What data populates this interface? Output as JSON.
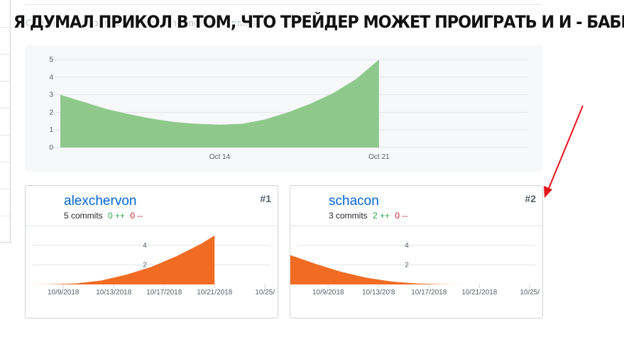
{
  "caption": "Я ДУМАЛ ПРИКОЛ В ТОМ, ЧТО ТРЕЙДЕР МОЖЕТ ПРОИГРАТЬ И И - БАБКИ",
  "subtitle": "Contributions to master, excluding merge commits",
  "colors": {
    "main_area": "#8ec98b",
    "user_area": "#f26b22",
    "link": "#0366d6",
    "add": "#28a745",
    "del": "#cb2431",
    "arrow": "#e8141b"
  },
  "chart_data": [
    {
      "type": "area",
      "title": "",
      "x_tick_labels": [
        "Oct 14",
        "Oct 21"
      ],
      "y_tick_labels": [
        "0",
        "1",
        "2",
        "3",
        "4",
        "5"
      ],
      "ylim": [
        0,
        5
      ],
      "x_range": [
        "10/7/2018",
        "10/23/2018"
      ],
      "x": [
        "10/7/2018",
        "10/8/2018",
        "10/9/2018",
        "10/10/2018",
        "10/11/2018",
        "10/12/2018",
        "10/13/2018",
        "10/14/2018",
        "10/15/2018",
        "10/16/2018",
        "10/17/2018",
        "10/18/2018",
        "10/19/2018",
        "10/20/2018",
        "10/21/2018"
      ],
      "series": [
        {
          "values": [
            3.0,
            2.6,
            2.2,
            1.9,
            1.65,
            1.45,
            1.35,
            1.3,
            1.35,
            1.6,
            2.0,
            2.5,
            3.1,
            3.9,
            5.0
          ]
        }
      ],
      "grid": true
    },
    {
      "type": "area",
      "title": "alexchervon",
      "x_tick_labels": [
        "10/9/2018",
        "10/13/2018",
        "10/17/2018",
        "10/21/2018",
        "10/25/"
      ],
      "y_tick_labels": [
        "2",
        "4"
      ],
      "ylim": [
        0,
        5
      ],
      "x_range": [
        "10/6/2018",
        "10/26/2018"
      ],
      "x": [
        "10/6/2018",
        "10/8/2018",
        "10/10/2018",
        "10/12/2018",
        "10/14/2018",
        "10/16/2018",
        "10/18/2018",
        "10/20/2018",
        "10/21/2018"
      ],
      "series": [
        {
          "values": [
            0,
            0.02,
            0.1,
            0.4,
            1.0,
            1.8,
            2.9,
            4.2,
            5.0
          ]
        }
      ],
      "grid": true
    },
    {
      "type": "area",
      "title": "schacon",
      "x_tick_labels": [
        "10/9/2018",
        "10/13/20'8",
        "10/17/2018",
        "10/21/2018",
        "10/25/"
      ],
      "y_tick_labels": [
        "2",
        "4"
      ],
      "ylim": [
        0,
        5
      ],
      "x_range": [
        "10/6/2018",
        "10/26/2018"
      ],
      "x": [
        "10/6/2018",
        "10/8/2018",
        "10/10/2018",
        "10/12/2018",
        "10/14/2018",
        "10/16/2018",
        "10/18/2018",
        "10/20/2018",
        "10/26/2018"
      ],
      "series": [
        {
          "values": [
            3.0,
            2.1,
            1.3,
            0.7,
            0.3,
            0.1,
            0.02,
            0,
            0
          ]
        }
      ],
      "grid": true
    }
  ],
  "contributors": [
    {
      "name": "alexchervon",
      "commits_label": "5 commits",
      "additions": "0 ++",
      "deletions": "0 --",
      "rank": "#1",
      "avatar": "avatar-photo-dark"
    },
    {
      "name": "schacon",
      "commits_label": "3 commits",
      "additions": "2 ++",
      "deletions": "0 --",
      "rank": "#2",
      "avatar": "avatar-photo-warm"
    }
  ],
  "annotation": {
    "icon": "red-arrow-icon"
  }
}
